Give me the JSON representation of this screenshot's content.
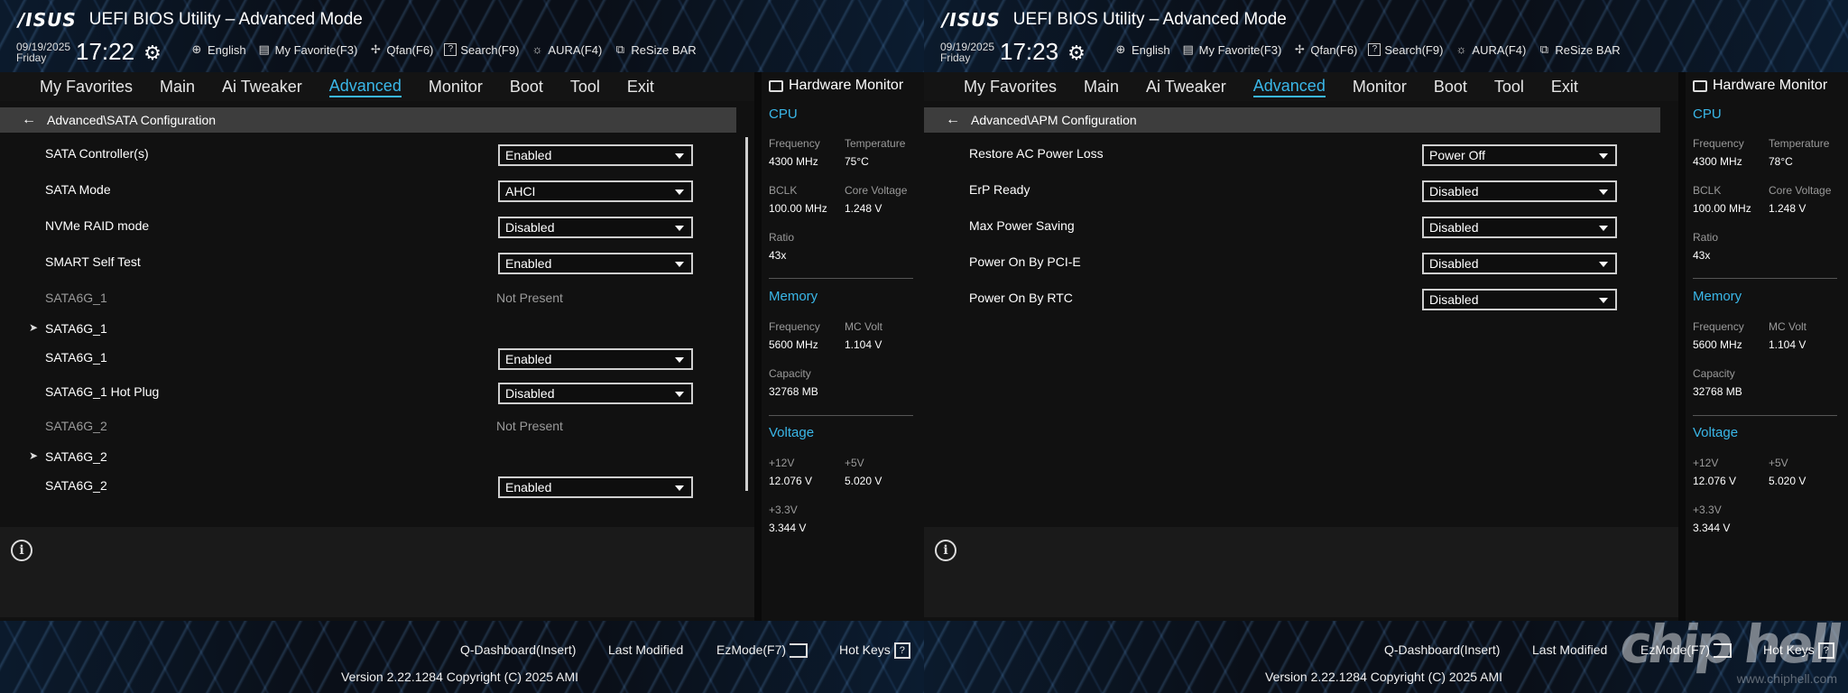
{
  "header": {
    "logo": "/ISUS",
    "title": "UEFI BIOS Utility – Advanced Mode",
    "day": "Friday",
    "gear_icon": "gear-icon",
    "toolbar": [
      {
        "label": "English",
        "icon": "globe-icon"
      },
      {
        "label": "My Favorite(F3)",
        "icon": "favorite-icon"
      },
      {
        "label": "Qfan(F6)",
        "icon": "fan-icon"
      },
      {
        "label": "Search(F9)",
        "icon": "search-help-icon"
      },
      {
        "label": "AURA(F4)",
        "icon": "aura-icon"
      },
      {
        "label": "ReSize BAR",
        "icon": "resize-bar-icon"
      }
    ]
  },
  "menu": [
    "My Favorites",
    "Main",
    "Ai Tweaker",
    "Advanced",
    "Monitor",
    "Boot",
    "Tool",
    "Exit"
  ],
  "active_menu": "Advanced",
  "accent_color": "#3ab7e8",
  "screens": [
    {
      "date": "09/19/2025",
      "time": "17:22",
      "breadcrumb": "Advanced\\SATA Configuration",
      "settings": [
        {
          "label": "SATA Controller(s)",
          "dropdown": "Enabled"
        },
        {
          "label": "SATA Mode",
          "dropdown": "AHCI"
        },
        {
          "label": "NVMe RAID mode",
          "dropdown": "Disabled"
        },
        {
          "label": "SMART Self Test",
          "dropdown": "Enabled"
        },
        {
          "label": "SATA6G_1",
          "text": "Not Present",
          "dim": true
        },
        {
          "label": "SATA6G_1",
          "submenu": true
        },
        {
          "label": "SATA6G_1",
          "dropdown": "Enabled"
        },
        {
          "label": "SATA6G_1 Hot Plug",
          "dropdown": "Disabled"
        },
        {
          "label": "SATA6G_2",
          "text": "Not Present",
          "dim": true
        },
        {
          "label": "SATA6G_2",
          "submenu": true
        },
        {
          "label": "SATA6G_2",
          "dropdown": "Enabled"
        }
      ]
    },
    {
      "date": "09/19/2025",
      "time": "17:23",
      "breadcrumb": "Advanced\\APM Configuration",
      "settings": [
        {
          "label": "Restore AC Power Loss",
          "dropdown": "Power Off"
        },
        {
          "label": "ErP Ready",
          "dropdown": "Disabled"
        },
        {
          "label": "Max Power Saving",
          "dropdown": "Disabled"
        },
        {
          "label": "Power On By PCI-E",
          "dropdown": "Disabled"
        },
        {
          "label": "Power On By RTC",
          "dropdown": "Disabled"
        }
      ]
    }
  ],
  "hardware_monitor": {
    "title": "Hardware Monitor",
    "cpu": {
      "section": "CPU",
      "frequency_label": "Frequency",
      "frequency": "4300 MHz",
      "temperature_label": "Temperature",
      "bclk_label": "BCLK",
      "bclk": "100.00 MHz",
      "core_voltage_label": "Core Voltage",
      "core_voltage": "1.248 V",
      "ratio_label": "Ratio",
      "ratio": "43x"
    },
    "cpu_temperature": [
      "75°C",
      "78°C"
    ],
    "memory": {
      "section": "Memory",
      "frequency_label": "Frequency",
      "frequency": "5600 MHz",
      "mc_volt_label": "MC Volt",
      "mc_volt": "1.104 V",
      "capacity_label": "Capacity",
      "capacity": "32768 MB"
    },
    "voltage": {
      "section": "Voltage",
      "v12_label": "+12V",
      "v12": "12.076 V",
      "v5_label": "+5V",
      "v5": "5.020 V",
      "v33_label": "+3.3V",
      "v33": "3.344 V"
    }
  },
  "footer": {
    "qdashboard": "Q-Dashboard(Insert)",
    "last_modified": "Last Modified",
    "ezmode": "EzMode(F7)",
    "hotkeys": "Hot Keys",
    "hotkeys_icon_text": "?",
    "version": "Version 2.22.1284 Copyright (C) 2025 AMI"
  },
  "watermark": {
    "logo": "chip hell",
    "url": "www.chiphell.com"
  }
}
